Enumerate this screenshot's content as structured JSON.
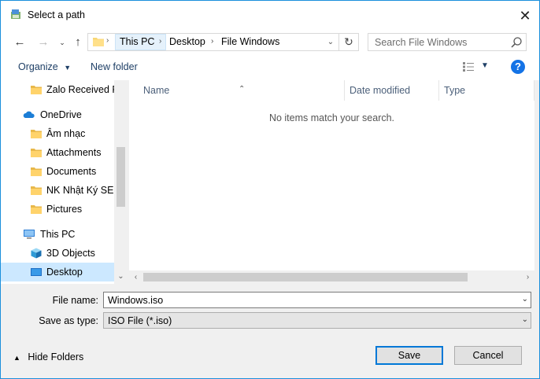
{
  "window": {
    "title": "Select a path"
  },
  "nav": {
    "back_icon": "arrow-left-icon",
    "forward_icon": "arrow-right-icon",
    "recent_icon": "chevron-down-icon",
    "up_icon": "arrow-up-icon"
  },
  "address": {
    "crumbs": [
      "This PC",
      "Desktop",
      "File Windows"
    ]
  },
  "search": {
    "placeholder": "Search File Windows"
  },
  "toolbar": {
    "organize_label": "Organize",
    "new_folder_label": "New folder"
  },
  "tree": {
    "items": [
      {
        "label": "Zalo Received Fi",
        "icon": "folder-icon"
      },
      {
        "label": "OneDrive",
        "icon": "cloud-icon"
      },
      {
        "label": "Âm nhạc",
        "icon": "folder-icon"
      },
      {
        "label": "Attachments",
        "icon": "folder-icon"
      },
      {
        "label": "Documents",
        "icon": "folder-icon"
      },
      {
        "label": "NK Nhật Ký SEO",
        "icon": "folder-icon"
      },
      {
        "label": "Pictures",
        "icon": "folder-icon"
      },
      {
        "label": "This PC",
        "icon": "computer-icon"
      },
      {
        "label": "3D Objects",
        "icon": "cube-icon"
      },
      {
        "label": "Desktop",
        "icon": "desktop-icon",
        "selected": true
      }
    ]
  },
  "columns": {
    "name": "Name",
    "date_modified": "Date modified",
    "type": "Type"
  },
  "content": {
    "empty_message": "No items match your search."
  },
  "form": {
    "file_name_label": "File name:",
    "file_name_value": "Windows.iso",
    "save_type_label": "Save as type:",
    "save_type_value": "ISO File (*.iso)"
  },
  "footer": {
    "hide_folders_label": "Hide Folders",
    "save_label": "Save",
    "cancel_label": "Cancel"
  },
  "colors": {
    "accent": "#0078d7",
    "selection": "#cce8ff",
    "border": "#1a8fdc"
  }
}
